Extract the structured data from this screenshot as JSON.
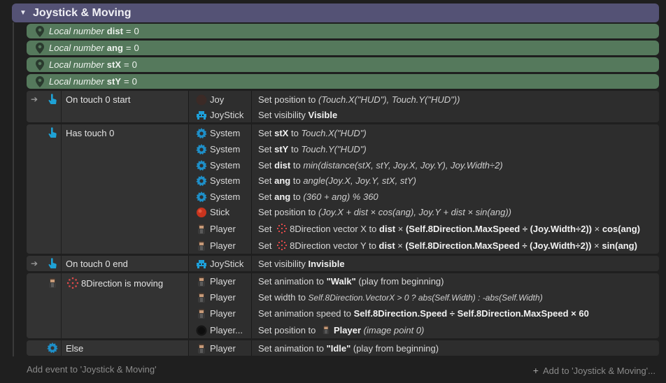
{
  "group": {
    "title": "Joystick & Moving",
    "collapse_icon": "triangle-down-icon"
  },
  "locals": [
    {
      "keyword": "Local number",
      "name": "dist",
      "eq": "=",
      "value": "0"
    },
    {
      "keyword": "Local number",
      "name": "ang",
      "eq": "=",
      "value": "0"
    },
    {
      "keyword": "Local number",
      "name": "stX",
      "eq": "=",
      "value": "0"
    },
    {
      "keyword": "Local number",
      "name": "stY",
      "eq": "=",
      "value": "0"
    }
  ],
  "events": [
    {
      "condition": {
        "trigger": true,
        "icon": "touch-icon",
        "label": "On touch 0 start"
      },
      "actions": [
        {
          "object": "Joy",
          "icon": "joy-circle-icon",
          "pre": "Set position to ",
          "segments": [
            [
              "i",
              "(Touch.X(\"HUD\"), Touch.Y(\"HUD\"))"
            ]
          ]
        },
        {
          "object": "JoyStick",
          "icon": "joystick-family-icon",
          "pre": "Set visibility ",
          "segments": [
            [
              "b",
              "Visible"
            ]
          ]
        }
      ]
    },
    {
      "condition": {
        "trigger": false,
        "icon": "touch-icon",
        "label": "Has touch 0"
      },
      "actions": [
        {
          "object": "System",
          "icon": "gear-icon",
          "text": [
            "Set ",
            "stX",
            " to ",
            "Touch.X(\"HUD\")"
          ]
        },
        {
          "object": "System",
          "icon": "gear-icon",
          "text": [
            "Set ",
            "stY",
            " to ",
            "Touch.Y(\"HUD\")"
          ]
        },
        {
          "object": "System",
          "icon": "gear-icon",
          "text": [
            "Set ",
            "dist",
            " to ",
            "min(distance(stX, stY, Joy.X, Joy.Y), Joy.Width÷2)"
          ]
        },
        {
          "object": "System",
          "icon": "gear-icon",
          "text": [
            "Set ",
            "ang",
            " to ",
            "angle(Joy.X, Joy.Y, stX, stY)"
          ]
        },
        {
          "object": "System",
          "icon": "gear-icon",
          "text": [
            "Set ",
            "ang",
            " to ",
            "(360 + ang) % 360"
          ]
        },
        {
          "object": "Stick",
          "icon": "stick-circle-icon",
          "text": [
            "Set position to ",
            "",
            "",
            "(Joy.X + dist × cos(ang), Joy.Y + dist × sin(ang))"
          ]
        },
        {
          "object": "Player",
          "icon": "player-icon",
          "text8": [
            "Set ",
            "8Direction vector X to ",
            "dist",
            " × ",
            "(Self.8Direction.MaxSpeed ÷ (Joy.Width÷2))",
            " × ",
            "cos(ang)"
          ]
        },
        {
          "object": "Player",
          "icon": "player-icon",
          "text8": [
            "Set ",
            "8Direction vector Y to ",
            "dist",
            " × ",
            "(Self.8Direction.MaxSpeed ÷ (Joy.Width÷2))",
            " × ",
            "sin(ang)"
          ]
        }
      ]
    },
    {
      "condition": {
        "trigger": true,
        "icon": "touch-icon",
        "label": "On touch 0 end"
      },
      "actions": [
        {
          "object": "JoyStick",
          "icon": "joystick-family-icon",
          "pre": "Set visibility ",
          "segments": [
            [
              "b",
              "Invisible"
            ]
          ]
        }
      ]
    },
    {
      "condition": {
        "trigger": false,
        "icon": "player-icon",
        "label": "8Direction is moving"
      },
      "actions": [
        {
          "object": "Player",
          "icon": "player-icon",
          "raw": [
            "Set animation to ",
            "\"Walk\"",
            " (play from beginning)"
          ]
        },
        {
          "object": "Player",
          "icon": "player-icon",
          "raw2": [
            "Set width to ",
            "Self.8Direction.VectorX > 0 ? abs(Self.Width) : -abs(Self.Width)"
          ]
        },
        {
          "object": "Player",
          "icon": "player-icon",
          "raw3": [
            "Set animation speed to ",
            "Self.8Direction.Speed ÷ Self.8Direction.MaxSpeed × 60"
          ]
        },
        {
          "object": "Player...",
          "icon": "shadow-icon",
          "raw4": [
            "Set position to ",
            "Player",
            "(image point 0)"
          ]
        }
      ]
    },
    {
      "condition": {
        "trigger": false,
        "icon": "gear-icon",
        "label": "Else"
      },
      "actions": [
        {
          "object": "Player",
          "icon": "player-icon",
          "raw": [
            "Set animation to ",
            "\"Idle\"",
            " (play from beginning)"
          ]
        }
      ]
    }
  ],
  "footer": {
    "add_event": "Add event to 'Joystick & Moving'",
    "add_to": "Add to 'Joystick & Moving'...",
    "plus": "+"
  },
  "colors": {
    "group_header": "#545275",
    "local_var": "#55795c",
    "touch_icon": "#1ea2d6",
    "gear_icon": "#1e8fc8"
  }
}
